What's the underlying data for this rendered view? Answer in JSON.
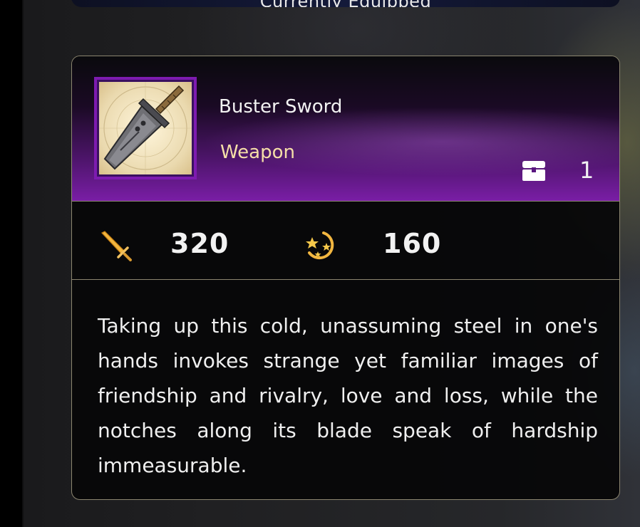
{
  "header": {
    "banner_text": "Currently Equipped"
  },
  "item": {
    "name": "Buster Sword",
    "type": "Weapon",
    "owned_count": "1",
    "thumbnail_icon": "buster-sword-icon"
  },
  "stats": {
    "attack": {
      "icon": "sword-attack-icon",
      "value": "320"
    },
    "magic": {
      "icon": "magic-stars-icon",
      "value": "160"
    }
  },
  "description": "Taking up this cold, unassuming steel in one's hands invokes strange yet familiar images of friendship and rivalry, love and loss, while the notches along its blade speak of hardship immeasurable.",
  "colors": {
    "accent_purple": "#7e1bb0",
    "frame_gold": "#8c8670",
    "type_label": "#f5dfa8"
  }
}
